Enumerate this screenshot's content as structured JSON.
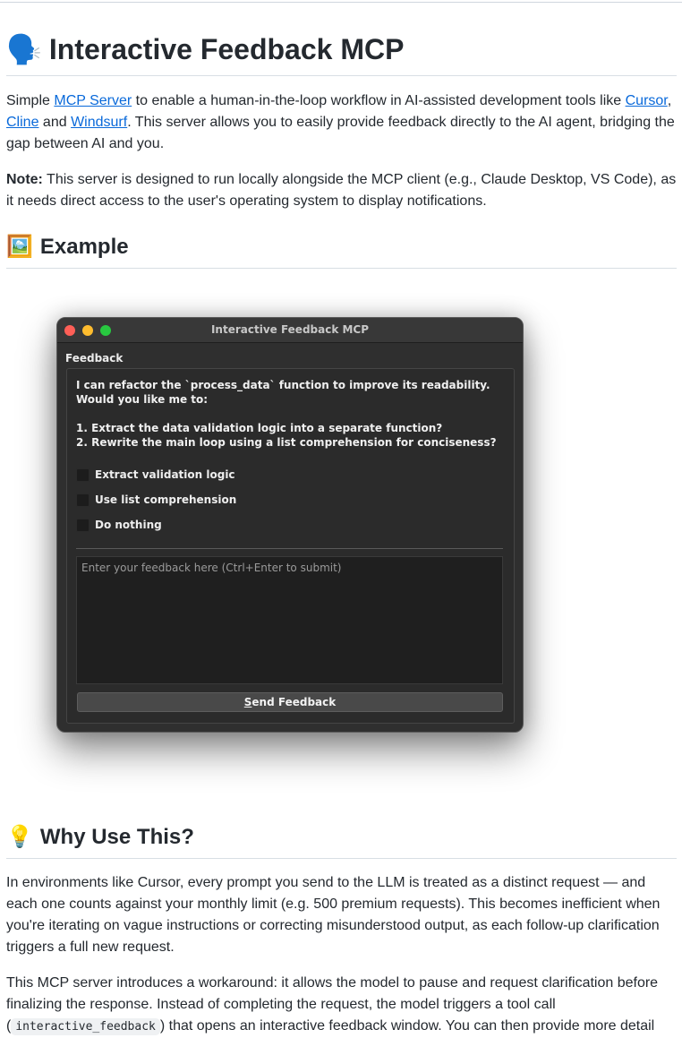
{
  "header": {
    "emoji": "🗣️",
    "title": "Interactive Feedback MCP"
  },
  "intro": {
    "text_1": "Simple ",
    "link_mcp_server": "MCP Server",
    "text_2": " to enable a human-in-the-loop workflow in AI-assisted development tools like ",
    "link_cursor": "Cursor",
    "text_3": ", ",
    "link_cline": "Cline",
    "text_4": " and ",
    "link_windsurf": "Windsurf",
    "text_5": ". This server allows you to easily provide feedback directly to the AI agent, bridging the gap between AI and you."
  },
  "note": {
    "label": "Note:",
    "text": " This server is designed to run locally alongside the MCP client (e.g., Claude Desktop, VS Code), as it needs direct access to the user's operating system to display notifications."
  },
  "example_section": {
    "emoji": "🖼️",
    "title": "Example"
  },
  "app_window": {
    "title": "Interactive Feedback MCP",
    "group_label": "Feedback",
    "question": "I can refactor the `process_data` function to improve its readability. Would you like me to:\n\n1. Extract the data validation logic into a separate function?\n2. Rewrite the main loop using a list comprehension for conciseness?",
    "options": [
      {
        "label": "Extract validation logic",
        "checked": false
      },
      {
        "label": "Use list comprehension",
        "checked": false
      },
      {
        "label": "Do nothing",
        "checked": false
      }
    ],
    "feedback_placeholder": "Enter your feedback here (Ctrl+Enter to submit)",
    "feedback_value": "",
    "send_button_mnemonic": "S",
    "send_button_rest": "end Feedback"
  },
  "why_section": {
    "emoji": "💡",
    "title": "Why Use This?"
  },
  "why_para_1": "In environments like Cursor, every prompt you send to the LLM is treated as a distinct request — and each one counts against your monthly limit (e.g. 500 premium requests). This becomes inefficient when you're iterating on vague instructions or correcting misunderstood output, as each follow-up clarification triggers a full new request.",
  "why_para_2": {
    "text_1": "This MCP server introduces a workaround: it allows the model to pause and request clarification before finalizing the response. Instead of completing the request, the model triggers a tool call (",
    "code": "interactive_feedback",
    "text_2": ") that opens an interactive feedback window. You can then provide more detail"
  },
  "colors": {
    "link": "#0969da",
    "text": "#24292f",
    "window_bg": "#2f2f2f",
    "traffic_red": "#ff5f57",
    "traffic_yellow": "#febc2e",
    "traffic_green": "#28c840"
  }
}
